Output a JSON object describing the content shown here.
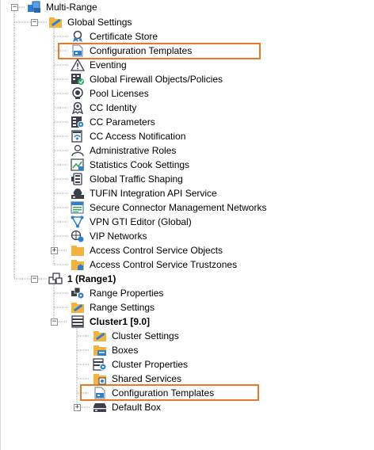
{
  "tree": {
    "root": {
      "label": "Multi-Range",
      "icon": "multi-range-icon"
    },
    "global_settings": {
      "label": "Global Settings",
      "icon": "folder-settings-icon",
      "children": [
        {
          "label": "Certificate Store",
          "icon": "certificate-icon"
        },
        {
          "label": "Configuration Templates",
          "icon": "config-template-icon",
          "highlighted": true
        },
        {
          "label": "Eventing",
          "icon": "warning-icon"
        },
        {
          "label": "Global Firewall Objects/Policies",
          "icon": "firewall-objects-icon"
        },
        {
          "label": "Pool Licenses",
          "icon": "license-icon"
        },
        {
          "label": "CC Identity",
          "icon": "identity-icon"
        },
        {
          "label": "CC Parameters",
          "icon": "parameters-icon"
        },
        {
          "label": "CC Access Notification",
          "icon": "access-notification-icon"
        },
        {
          "label": "Administrative Roles",
          "icon": "admin-roles-icon"
        },
        {
          "label": "Statistics Cook Settings",
          "icon": "statistics-icon"
        },
        {
          "label": "Global Traffic Shaping",
          "icon": "traffic-shaping-icon"
        },
        {
          "label": "TUFIN Integration API Service",
          "icon": "tufin-icon"
        },
        {
          "label": "Secure Connector Management Networks",
          "icon": "secure-connector-icon"
        },
        {
          "label": "VPN GTI Editor (Global)",
          "icon": "vpn-gti-icon"
        },
        {
          "label": "VIP Networks",
          "icon": "vip-networks-icon"
        },
        {
          "label": "Access Control Service Objects",
          "icon": "folder-icon",
          "expand": "+"
        },
        {
          "label": "Access Control Service Trustzones",
          "icon": "folder-puzzle-icon"
        }
      ]
    },
    "range": {
      "label": "1 (Range1)",
      "icon": "range-icon",
      "children": [
        {
          "label": "Range Properties",
          "icon": "range-properties-icon"
        },
        {
          "label": "Range Settings",
          "icon": "folder-settings-icon"
        }
      ],
      "cluster": {
        "label": "Cluster1 [9.0]",
        "icon": "cluster-icon",
        "children": [
          {
            "label": "Cluster Settings",
            "icon": "folder-settings-icon"
          },
          {
            "label": "Boxes",
            "icon": "boxes-icon"
          },
          {
            "label": "Cluster Properties",
            "icon": "cluster-properties-icon"
          },
          {
            "label": "Shared Services",
            "icon": "shared-services-icon"
          },
          {
            "label": "Configuration Templates",
            "icon": "config-template-icon",
            "highlighted": true
          },
          {
            "label": "Default Box",
            "icon": "default-box-icon",
            "expand": "+"
          }
        ]
      }
    },
    "highlight_color": "#e8782a",
    "toggles": {
      "expanded": "−",
      "collapsed": "+"
    }
  }
}
